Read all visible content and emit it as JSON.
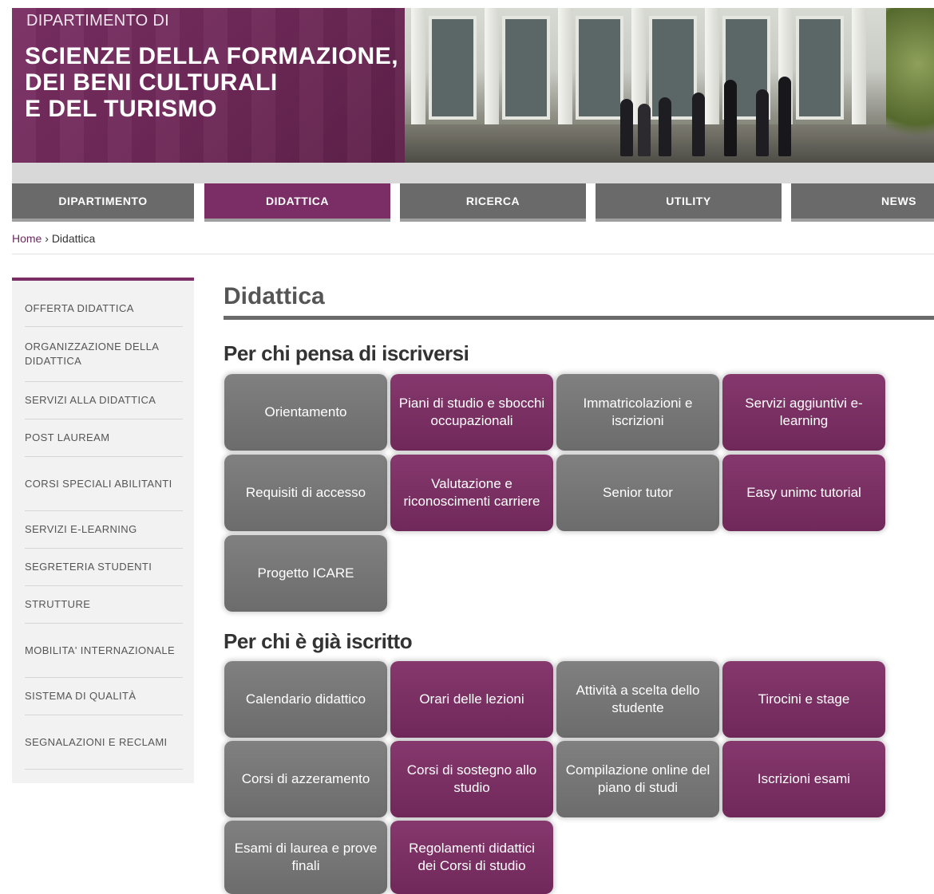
{
  "header": {
    "pre_title": "DIPARTIMENTO DI",
    "title_lines": [
      "SCIENZE DELLA FORMAZIONE,",
      "DEI BENI CULTURALI",
      "E DEL TURISMO"
    ]
  },
  "nav": {
    "items": [
      "DIPARTIMENTO",
      "DIDATTICA",
      "RICERCA",
      "UTILITY",
      "NEWS"
    ],
    "active": "DIDATTICA"
  },
  "breadcrumb": {
    "home": "Home",
    "separator": " › ",
    "current": "Didattica"
  },
  "sidebar": {
    "items": [
      "OFFERTA DIDATTICA",
      "ORGANIZZAZIONE DELLA DIDATTICA",
      "SERVIZI ALLA DIDATTICA",
      "POST LAUREAM",
      "CORSI SPECIALI ABILITANTI",
      "SERVIZI E-LEARNING",
      "SEGRETERIA STUDENTI",
      "STRUTTURE",
      "MOBILITA' INTERNAZIONALE",
      "SISTEMA DI QUALITÀ",
      "SEGNALAZIONI E RECLAMI"
    ]
  },
  "main": {
    "title": "Didattica",
    "sections": [
      {
        "title": "Per chi pensa di iscriversi",
        "tiles": [
          "Orientamento",
          "Piani di studio e sbocchi occupazionali",
          "Immatricolazioni e iscrizioni",
          "Servizi aggiuntivi e-learning",
          "Requisiti di accesso",
          "Valutazione e riconoscimenti carriere",
          "Senior tutor",
          "Easy unimc tutorial",
          "Progetto ICARE"
        ]
      },
      {
        "title": "Per chi è già iscritto",
        "tiles": [
          "Calendario didattico",
          "Orari delle lezioni",
          "Attività a scelta dello studente",
          "Tirocini e stage",
          "Corsi di azzeramento",
          "Corsi di sostegno allo studio",
          "Compilazione online del piano di studi",
          "Iscrizioni esami",
          "Esami di laurea e prove finali",
          "Regolamenti didattici dei Corsi di studio"
        ]
      }
    ]
  },
  "colors": {
    "brand": "#7b2d66",
    "tile_gray": "#767676",
    "nav_gray": "#6a6a6a"
  }
}
